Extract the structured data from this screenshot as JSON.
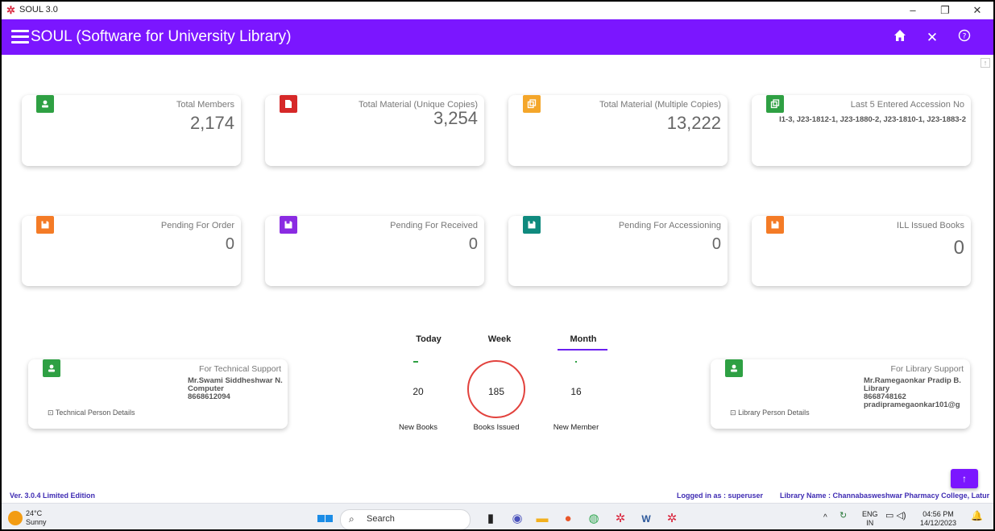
{
  "window": {
    "title": "SOUL 3.0",
    "minimize": "–",
    "restore": "❐",
    "close": "✕"
  },
  "appbar": {
    "title": "SOUL (Software for University Library)",
    "home_icon": "home-icon",
    "close_icon": "close-icon",
    "help_icon": "help-icon"
  },
  "cards_row1": [
    {
      "label": "Total Members",
      "value": "2,174",
      "color": "#2ea043",
      "icon": "person-icon"
    },
    {
      "label": "Total Material (Unique Copies)",
      "value": "3,254",
      "color": "#d62828",
      "icon": "file-icon"
    },
    {
      "label": "Total Material (Multiple Copies)",
      "value": "13,222",
      "color": "#f4a62a",
      "icon": "copy-icon"
    },
    {
      "label": "Last 5 Entered Accession No",
      "value": "I1-3, J23-1812-1, J23-1880-2, J23-1810-1, J23-1883-2",
      "color": "#2ea043",
      "icon": "copy-icon"
    }
  ],
  "cards_row2": [
    {
      "label": "Pending For Order",
      "value": "0",
      "color": "#f47b26",
      "icon": "save-icon"
    },
    {
      "label": "Pending For Received",
      "value": "0",
      "color": "#8a2be2",
      "icon": "save-icon"
    },
    {
      "label": "Pending For Accessioning",
      "value": "0",
      "color": "#0f8a7e",
      "icon": "save-icon"
    },
    {
      "label": "ILL Issued Books",
      "value": "0",
      "color": "#f47b26",
      "icon": "save-icon"
    }
  ],
  "tech_support": {
    "label": "For Technical Support",
    "name": "Mr.Swami Siddheshwar N.",
    "dept": "Computer",
    "phone": "8668612094",
    "link": "Technical Person Details",
    "color": "#2ea043"
  },
  "lib_support": {
    "label": "For Library Support",
    "name": "Mr.Ramegaonkar Pradip B.",
    "dept": "Library",
    "phone": "8668748162",
    "email": "pradipramegaonkar101@g",
    "link": "Library Person Details",
    "color": "#2ea043"
  },
  "stats": {
    "tabs": [
      "Today",
      "Week",
      "Month"
    ],
    "active_tab": "Month",
    "new_books": "20",
    "books_issued": "185",
    "new_member": "16",
    "new_books_label": "New Books",
    "books_issued_label": "Books Issued",
    "new_member_label": "New Member"
  },
  "status": {
    "version": "Ver. 3.0.4  Limited Edition",
    "logged_in": "Logged in as : superuser",
    "library_name": "Library Name : Channabasweshwar Pharmacy College, Latur"
  },
  "taskbar": {
    "temp": "24°C",
    "weather": "Sunny",
    "search": "Search",
    "lang1": "ENG",
    "lang2": "IN",
    "time": "04:56 PM",
    "date": "14/12/2023"
  }
}
